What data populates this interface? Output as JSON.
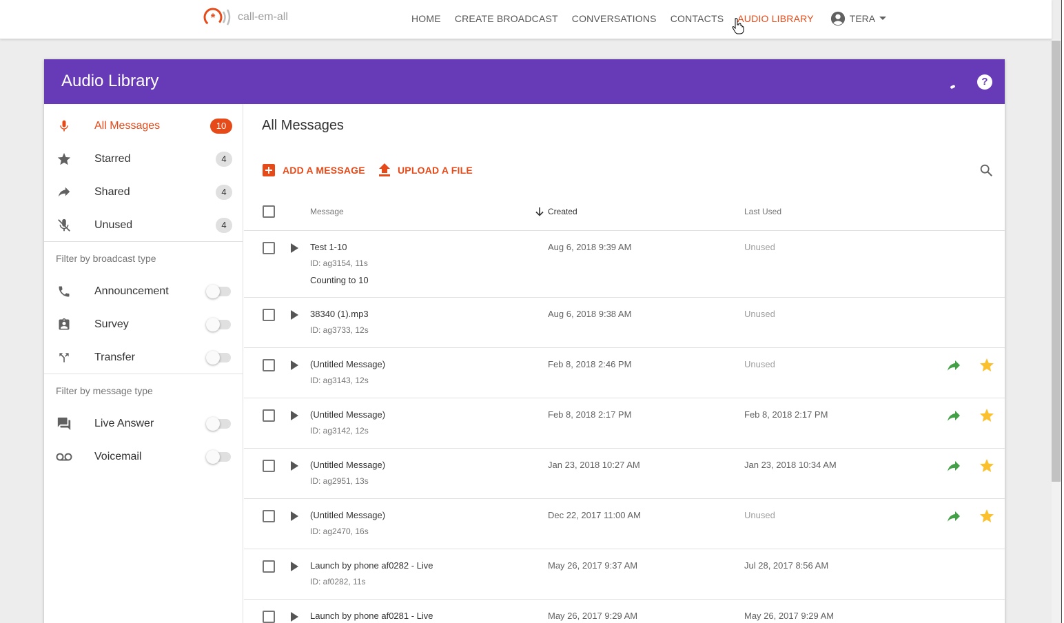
{
  "brand": {
    "name": "call-em-all",
    "accent": "#e64a19",
    "header_color": "#673ab7"
  },
  "nav": {
    "items": [
      {
        "label": "HOME"
      },
      {
        "label": "CREATE BROADCAST"
      },
      {
        "label": "CONVERSATIONS"
      },
      {
        "label": "CONTACTS"
      },
      {
        "label": "AUDIO LIBRARY"
      }
    ],
    "active": "AUDIO LIBRARY",
    "user": "TERA"
  },
  "page": {
    "title": "Audio Library"
  },
  "sidebar": {
    "folders": [
      {
        "label": "All Messages",
        "count": "10",
        "icon": "mic-icon"
      },
      {
        "label": "Starred",
        "count": "4",
        "icon": "star-icon"
      },
      {
        "label": "Shared",
        "count": "4",
        "icon": "share-icon"
      },
      {
        "label": "Unused",
        "count": "4",
        "icon": "mic-off-icon"
      }
    ],
    "broadcast_filter": {
      "title": "Filter by broadcast type",
      "items": [
        {
          "label": "Announcement",
          "icon": "phone-icon",
          "on": false
        },
        {
          "label": "Survey",
          "icon": "clipboard-account-icon",
          "on": false
        },
        {
          "label": "Transfer",
          "icon": "call-split-icon",
          "on": false
        }
      ]
    },
    "message_filter": {
      "title": "Filter by message type",
      "items": [
        {
          "label": "Live Answer",
          "icon": "forum-icon",
          "on": false
        },
        {
          "label": "Voicemail",
          "icon": "voicemail-icon",
          "on": false
        }
      ]
    }
  },
  "main": {
    "title": "All Messages",
    "add_label": "ADD A MESSAGE",
    "upload_label": "UPLOAD A FILE",
    "columns": {
      "message": "Message",
      "created": "Created",
      "last_used": "Last Used"
    },
    "rows": [
      {
        "name": "Test 1-10",
        "id": "ID: ag3154, 11s",
        "desc": "Counting to 10",
        "created": "Aug 6, 2018 9:39 AM",
        "last_used": "Unused",
        "shared": false,
        "starred": false
      },
      {
        "name": "38340 (1).mp3",
        "id": "ID: ag3733, 12s",
        "desc": "",
        "created": "Aug 6, 2018 9:38 AM",
        "last_used": "Unused",
        "shared": false,
        "starred": false
      },
      {
        "name": "(Untitled Message)",
        "id": "ID: ag3143, 12s",
        "desc": "",
        "created": "Feb 8, 2018 2:46 PM",
        "last_used": "Unused",
        "shared": true,
        "starred": true
      },
      {
        "name": "(Untitled Message)",
        "id": "ID: ag3142, 12s",
        "desc": "",
        "created": "Feb 8, 2018 2:17 PM",
        "last_used": "Feb 8, 2018 2:17 PM",
        "shared": true,
        "starred": true
      },
      {
        "name": "(Untitled Message)",
        "id": "ID: ag2951, 13s",
        "desc": "",
        "created": "Jan 23, 2018 10:27 AM",
        "last_used": "Jan 23, 2018 10:34 AM",
        "shared": true,
        "starred": true
      },
      {
        "name": "(Untitled Message)",
        "id": "ID: ag2470, 16s",
        "desc": "",
        "created": "Dec 22, 2017 11:00 AM",
        "last_used": "Unused",
        "shared": true,
        "starred": true
      },
      {
        "name": "Launch by phone af0282 - Live",
        "id": "ID: af0282, 11s",
        "desc": "",
        "created": "May 26, 2017 9:37 AM",
        "last_used": "Jul 28, 2017 8:56 AM",
        "shared": false,
        "starred": false
      },
      {
        "name": "Launch by phone af0281 - Live",
        "id": "",
        "desc": "",
        "created": "May 26, 2017 9:29 AM",
        "last_used": "May 26, 2017 9:29 AM",
        "shared": false,
        "starred": false
      }
    ]
  },
  "colors": {
    "share": "#43a047",
    "star": "#fbc02d",
    "unused_text": "#9e9e9e"
  }
}
